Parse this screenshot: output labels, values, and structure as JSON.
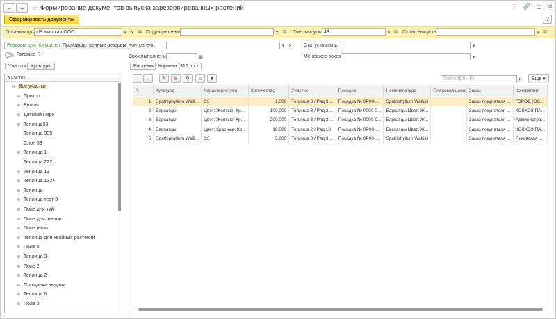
{
  "window": {
    "title": "Формирование документов выпуска зарезервированных растений",
    "controls": [
      "⋮",
      "🔗",
      "▢",
      "✕"
    ]
  },
  "actions": {
    "generate_label": "Сформировать документы",
    "help_label": "?"
  },
  "filters": {
    "org_label": "Организация:",
    "org_value": "«Ромашка» ООО",
    "dept_label": "Подразделение:",
    "dept_value": "",
    "account_label": "Счет выпуска:",
    "account_value": "43",
    "warehouse_label": "Склад выпуска:",
    "warehouse_value": ""
  },
  "mode": {
    "reserves_label": "Резервы для покупателей",
    "production_label": "Производственные резервы",
    "ready_label": "Готовые",
    "ready_help": "?"
  },
  "order_filters": {
    "counterparty_label": "Контрагент:",
    "deadline_label": "Срок выполнения:",
    "deadline_value": ". .",
    "payment_label": "Статус оплаты:",
    "manager_label": "Менеджер заказа:"
  },
  "left_tabs": [
    "Участки",
    "Культуры"
  ],
  "tree": {
    "header": "Участок",
    "items": [
      {
        "label": "Все участки",
        "exp": "⊟",
        "indent": 0,
        "hl": true
      },
      {
        "label": "Прикоп",
        "exp": "⊕",
        "indent": 1
      },
      {
        "label": "Виллы",
        "exp": "⊕",
        "indent": 1
      },
      {
        "label": "Детский Парк",
        "exp": "⊕",
        "indent": 1
      },
      {
        "label": "Теплица33",
        "exp": "⊕",
        "indent": 1
      },
      {
        "label": "Теплица 305",
        "exp": "",
        "indent": 1
      },
      {
        "label": "Слон 33",
        "exp": "",
        "indent": 1
      },
      {
        "label": "Теплица 1",
        "exp": "⊕",
        "indent": 1
      },
      {
        "label": "Теплица 222",
        "exp": "",
        "indent": 1
      },
      {
        "label": "Теплица 13",
        "exp": "⊕",
        "indent": 1
      },
      {
        "label": "Теплица 1234",
        "exp": "⊕",
        "indent": 1
      },
      {
        "label": "Теплица",
        "exp": "⊕",
        "indent": 1
      },
      {
        "label": "Теплица  тест 3",
        "exp": "⊕",
        "indent": 1
      },
      {
        "label": "Поле для туй",
        "exp": "⊕",
        "indent": 1
      },
      {
        "label": "Поле для цветов",
        "exp": "⊕",
        "indent": 1
      },
      {
        "label": "Поле (ели)",
        "exp": "⊕",
        "indent": 1
      },
      {
        "label": "Теплица для хвойных растений",
        "exp": "⊕",
        "indent": 1
      },
      {
        "label": "Поле 5",
        "exp": "⊕",
        "indent": 1
      },
      {
        "label": "Теплица 3",
        "exp": "⊕",
        "indent": 1
      },
      {
        "label": "Поле 2",
        "exp": "⊕",
        "indent": 1
      },
      {
        "label": "Теплица 2",
        "exp": "⊕",
        "indent": 1
      },
      {
        "label": "Площадка выдачи",
        "exp": "⊕",
        "indent": 1
      },
      {
        "label": "Теплица 6",
        "exp": "⊕",
        "indent": 1
      },
      {
        "label": "Поле 3",
        "exp": "⊕",
        "indent": 1
      }
    ]
  },
  "right_tabs": [
    "Растения",
    "Корзина (316 шт.)"
  ],
  "grid_tools": {
    "search_placeholder": "Поиск (Ctrl+F)",
    "more_label": "Еще"
  },
  "grid": {
    "columns": [
      "N",
      "Культура",
      "Характеристика",
      "Количество",
      "Участок",
      "Посадка",
      "Номенклатура",
      "Плановая цена",
      "Заказ",
      "Контрагент"
    ],
    "rows": [
      [
        "1",
        "Spathiphyllum Walli...",
        "C3",
        "1,000",
        "Теплица 3 / Ряд 3 ...",
        "Посадка № 0Р00-...",
        "Spahiphyllum Wallisii",
        "",
        "Заказ покупателя ...",
        "ГОРОД (ОС..."
      ],
      [
        "2",
        "Бархатцы",
        "Цвет: Желтые; Кр...",
        "100,000",
        "Теплица 3 / Ряд 2 ...",
        "Посадка № 0000-0...",
        "Бархатцы Цвет: Ж...",
        "",
        "Заказ покупателя ...",
        "КОЛХОЗ ПА..."
      ],
      [
        "3",
        "Бархатцы",
        "Цвет: Желтые; Кр...",
        "200,000",
        "Теплица 3 / Ряд 2 ...",
        "Посадка № 0000-0...",
        "Бархатцы Цвет: Ж...",
        "",
        "Заказ покупателя ...",
        "Администра..."
      ],
      [
        "4",
        "Бархатцы",
        "Цвет: Красные; Кр...",
        "10,000",
        "Теплица 2 / Ряд 18",
        "Посадка № 0Р00-...",
        "Бархатцы Цвет: Ж...",
        "",
        "Заказ покупателя ...",
        "КОЛХОЗ ПА..."
      ],
      [
        "5",
        "Spathiphyllum Walli...",
        "C3",
        "5,000",
        "Теплица 3 / Ряд 3 ...",
        "Посадка № 0Р00-...",
        "Spahiphyllum Wallisii",
        "",
        "Заказ покупателя ...",
        "Янковская ..."
      ]
    ]
  }
}
